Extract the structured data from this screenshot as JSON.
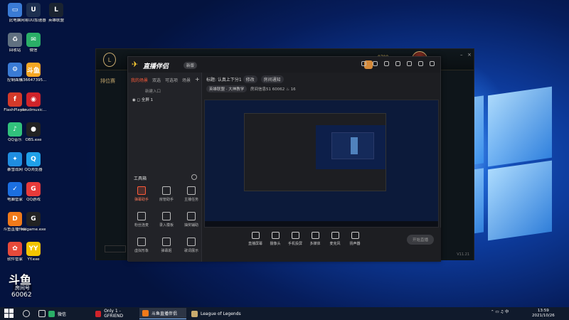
{
  "desktop": {
    "icons": [
      {
        "label": "此电脑",
        "color": "#3a7bd5",
        "glyph": "▭"
      },
      {
        "label": "网易UU加速器",
        "color": "#1e3050",
        "glyph": "U"
      },
      {
        "label": "英雄联盟",
        "color": "#1a2330",
        "glyph": "L"
      },
      {
        "label": "回收站",
        "color": "#607080",
        "glyph": "♻"
      },
      {
        "label": "微信",
        "color": "#2aae67",
        "glyph": "✉"
      },
      {
        "label": "控制面板",
        "color": "#3a7bd5",
        "glyph": "⚙"
      },
      {
        "label": "636647395...",
        "color": "#f5a623",
        "glyph": "斗鱼"
      },
      {
        "label": "FlashPlayer",
        "color": "#d43a2a",
        "glyph": "f"
      },
      {
        "label": "cloudmusic...",
        "color": "#d0232a",
        "glyph": "◉"
      },
      {
        "label": "QQ音乐",
        "color": "#31c27c",
        "glyph": "♪"
      },
      {
        "label": "OBS.exe",
        "color": "#222222",
        "glyph": "●"
      },
      {
        "label": "暴雪战网",
        "color": "#1f8de0",
        "glyph": "✦"
      },
      {
        "label": "QQ浏览器",
        "color": "#1fa0e8",
        "glyph": "Q"
      },
      {
        "label": "电脑管家",
        "color": "#1b6fe0",
        "glyph": "✓"
      },
      {
        "label": "QQ游戏",
        "color": "#e83a3a",
        "glyph": "G"
      },
      {
        "label": "斗鱼直播伴侣",
        "color": "#f07a1a",
        "glyph": "D"
      },
      {
        "label": "wegame.exe",
        "color": "#222222",
        "glyph": "G"
      },
      {
        "label": "软件管家",
        "color": "#e84a3a",
        "glyph": "✿"
      },
      {
        "label": "YY.exe",
        "color": "#f2c400",
        "glyph": "YY"
      }
    ]
  },
  "lol": {
    "coins": "8799",
    "side_label": "排位赛",
    "right_label": "",
    "version": "V11.21"
  },
  "companion": {
    "app_name": "直播伴侣",
    "version_badge": "新版",
    "left_tabs": [
      "我的场景",
      "双选",
      "可选项",
      "场景"
    ],
    "scene_add": "+",
    "scene_hint": "新建入口",
    "scene_item": "全屏 1",
    "tools_title": "工具箱",
    "tools": [
      {
        "label": "弹幕助手",
        "red": true
      },
      {
        "label": "房管助手",
        "red": false
      },
      {
        "label": "主播任务",
        "red": false
      },
      {
        "label": "粉丝连麦",
        "red": false
      },
      {
        "label": "录入模板",
        "red": false
      },
      {
        "label": "抽奖辅助",
        "red": false
      },
      {
        "label": "虚拟形象",
        "red": false
      },
      {
        "label": "弹幕姬",
        "red": false
      },
      {
        "label": "歌词展示",
        "red": false
      }
    ],
    "header_title": "标题: 认真上下分1",
    "header_edit": "修改",
    "header_notice": "房间通知",
    "header_category": "英雄联盟 · 大神教学",
    "header_room": "房间信息51",
    "header_count": "60062",
    "header_hot": "16",
    "bottom_tools": [
      {
        "label": "直播屏幕"
      },
      {
        "label": "摄像头"
      },
      {
        "label": "手机投屏"
      },
      {
        "label": "多媒体"
      },
      {
        "label": "麦克风"
      },
      {
        "label": "扬声器"
      }
    ],
    "start_live": "开始直播"
  },
  "watermark": {
    "logo": "斗鱼",
    "room_label": "房间号",
    "room_number": "60062"
  },
  "taskbar": {
    "items": [
      {
        "label": "微信",
        "color": "#2aae67"
      },
      {
        "label": "Only 1 - GFRIEND",
        "color": "#d0232a"
      },
      {
        "label": "斗鱼直播伴侣",
        "color": "#f07a1a"
      },
      {
        "label": "League of Legends",
        "color": "#c8aa6e"
      }
    ],
    "time": "13:59",
    "date": "2021/10/26"
  }
}
